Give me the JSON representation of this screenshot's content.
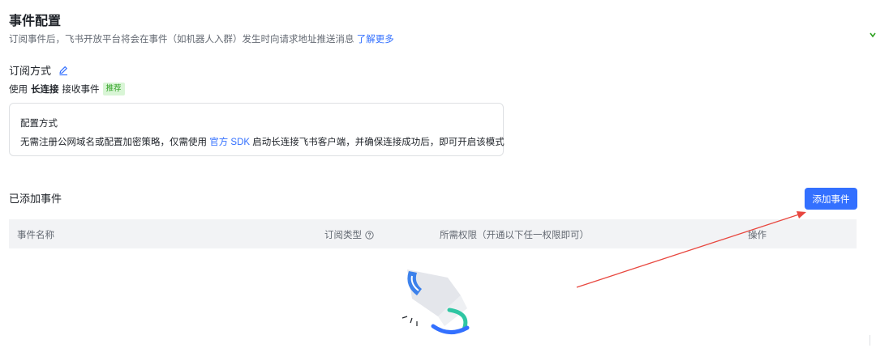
{
  "page": {
    "title": "事件配置",
    "description": "订阅事件后，飞书开放平台将会在事件（如机器人入群）发生时向请求地址推送消息",
    "learn_more": "了解更多"
  },
  "subscription": {
    "title": "订阅方式",
    "edit_icon": "pencil-icon",
    "method_prefix": "使用",
    "method_name": "长连接",
    "method_suffix": "接收事件",
    "recommend_tag": "推荐"
  },
  "config_card": {
    "title": "配置方式",
    "text_before": "无需注册公网域名或配置加密策略，仅需使用",
    "sdk_link": "官方 SDK",
    "text_after": "启动长连接飞书客户端，并确保连接成功后，即可开启该模式"
  },
  "events": {
    "title": "已添加事件",
    "add_button": "添加事件",
    "columns": {
      "name": "事件名称",
      "type": "订阅类型",
      "permission": "所需权限（开通以下任一权限即可）",
      "action": "操作"
    },
    "help_icon": "question-circle-icon",
    "empty_icon": "empty-box-icon"
  },
  "colors": {
    "primary": "#3370ff",
    "tag_bg": "#d9f5d6",
    "tag_text": "#2ea121",
    "annotation_arrow": "#e8473f"
  }
}
